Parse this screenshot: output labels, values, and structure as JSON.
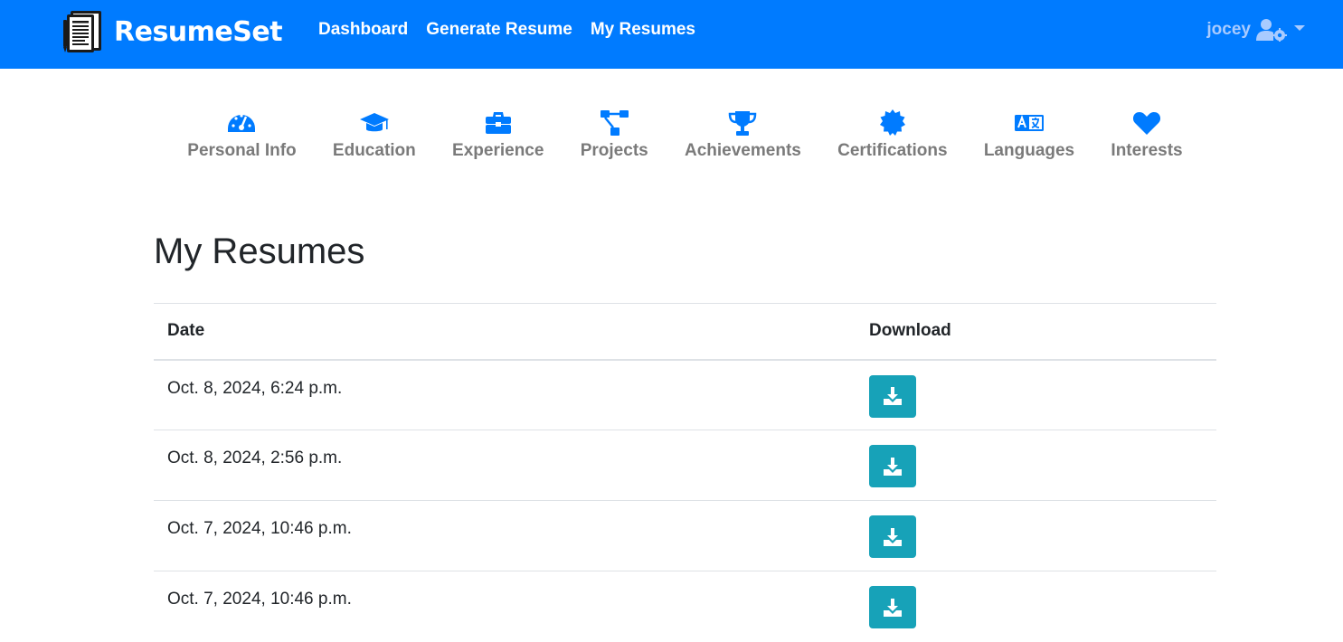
{
  "navbar": {
    "brand": "ResumeSet",
    "links": [
      "Dashboard",
      "Generate Resume",
      "My Resumes"
    ],
    "user": "jocey",
    "colors": {
      "bar": "#007bff",
      "user_text": "#a9cbff"
    }
  },
  "sections": [
    {
      "label": "Personal Info",
      "icon": "tachometer-icon"
    },
    {
      "label": "Education",
      "icon": "graduation-cap-icon"
    },
    {
      "label": "Experience",
      "icon": "briefcase-icon"
    },
    {
      "label": "Projects",
      "icon": "project-diagram-icon"
    },
    {
      "label": "Achievements",
      "icon": "trophy-icon"
    },
    {
      "label": "Certifications",
      "icon": "certificate-icon"
    },
    {
      "label": "Languages",
      "icon": "language-icon"
    },
    {
      "label": "Interests",
      "icon": "heart-icon"
    }
  ],
  "page": {
    "title": "My Resumes"
  },
  "table": {
    "headers": [
      "Date",
      "Download"
    ],
    "rows": [
      {
        "date": "Oct. 8, 2024, 6:24 p.m."
      },
      {
        "date": "Oct. 8, 2024, 2:56 p.m."
      },
      {
        "date": "Oct. 7, 2024, 10:46 p.m."
      },
      {
        "date": "Oct. 7, 2024, 10:46 p.m."
      }
    ],
    "download_icon": "download-icon",
    "download_color": "#17a2b8"
  }
}
